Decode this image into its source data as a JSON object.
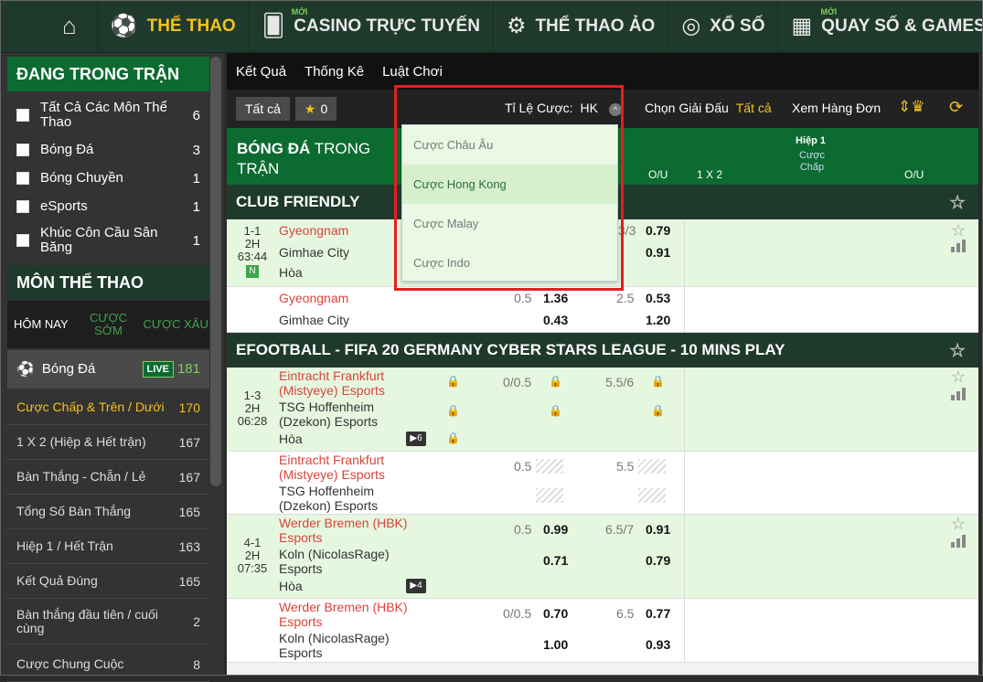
{
  "nav": {
    "home": "home-icon",
    "items": [
      {
        "label": "THỂ THAO",
        "active": true,
        "icon": "soccer-ball-icon"
      },
      {
        "label": "CASINO TRỰC TUYẾN",
        "badge": "MỚI",
        "icon": "cards-icon"
      },
      {
        "label": "THỂ THAO ẢO",
        "icon": "virtual-sports-icon"
      },
      {
        "label": "XỔ SỐ",
        "icon": "lottery-icon"
      },
      {
        "label": "QUAY SỐ & GAMES",
        "badge": "MỚI",
        "icon": "slot-machine-icon"
      }
    ]
  },
  "sidebar": {
    "live_title": "ĐANG TRONG TRẬN",
    "live_items": [
      {
        "label": "Tất Cả Các Môn Thể Thao",
        "count": "6"
      },
      {
        "label": "Bóng Đá",
        "count": "3"
      },
      {
        "label": "Bóng Chuyền",
        "count": "1"
      },
      {
        "label": "eSports",
        "count": "1"
      },
      {
        "label": "Khúc Côn Cầu Sân Băng",
        "count": "1"
      }
    ],
    "sports_title": "MÔN THỂ THAO",
    "tabs": [
      "HÔM NAY",
      "CƯỢC SỚM",
      "CƯỢC XÂU"
    ],
    "sport": {
      "label": "Bóng Đá",
      "live": "LIVE",
      "count": "181"
    },
    "menu": [
      {
        "label": "Cược Chấp & Trên / Dưới",
        "count": "170",
        "active": true
      },
      {
        "label": "1 X 2 (Hiệp & Hết trận)",
        "count": "167"
      },
      {
        "label": "Bàn Thắng - Chẵn / Lẻ",
        "count": "167"
      },
      {
        "label": "Tổng Số Bàn Thắng",
        "count": "165"
      },
      {
        "label": "Hiệp 1 / Hết Trận",
        "count": "163"
      },
      {
        "label": "Kết Quả Đúng",
        "count": "165"
      },
      {
        "label": "Bàn thắng đầu tiên / cuối cùng",
        "count": "2"
      },
      {
        "label": "Cược Chung Cuộc",
        "count": "8"
      }
    ]
  },
  "subtabs": [
    "Kết Quả",
    "Thống Kê",
    "Luật Chơi"
  ],
  "toolbar": {
    "all": "Tất cả",
    "fav_count": "0",
    "odds_label": "Tỉ Lệ Cược:",
    "odds_value": "HK",
    "league_label": "Chọn Giải Đấu",
    "league_value": "Tất cả",
    "single_view": "Xem Hàng Đơn"
  },
  "dropdown": {
    "options": [
      "Cược Châu Âu",
      "Cược Hong Kong",
      "Cược Malay",
      "Cược Indo"
    ],
    "selected": 1
  },
  "header": {
    "title_a": "BÓNG ĐÁ",
    "title_b": "TRONG",
    "title_c": "TRẬN",
    "col_ou": "O/U",
    "col_1x2": "1 X 2",
    "half": "Hiệp 1",
    "col_handicap": "Cược Chấp",
    "col_ou2": "O/U"
  },
  "leagues": [
    {
      "name": "CLUB FRIENDLY"
    },
    {
      "name": "EFOOTBALL - FIFA 20 GERMANY CYBER STARS LEAGUE - 10 MINS PLAY"
    }
  ],
  "m1": {
    "score": "1-1",
    "half": "2H",
    "time": "63:44",
    "n": "N",
    "home": "Gyeongnam",
    "away": "Gimhae City",
    "draw": "Hòa",
    "ou_line": "3/3",
    "ou_over": "0.79",
    "ou_under": "0.91"
  },
  "m1b": {
    "home": "Gyeongnam",
    "away": "Gimhae City",
    "hdp": "0.5",
    "hdp_home": "1.36",
    "hdp_away": "0.43",
    "ou_line": "2.5",
    "ou_over": "0.53",
    "ou_under": "1.20"
  },
  "m2": {
    "score": "1-3",
    "half": "2H",
    "time": "06:28",
    "home": "Eintracht Frankfurt (Mistyeye) Esports",
    "away": "TSG Hoffenheim (Dzekon) Esports",
    "draw": "Hòa",
    "hdp": "0/0.5",
    "ou_line": "5.5/6",
    "badge": "6"
  },
  "m2b": {
    "home": "Eintracht Frankfurt (Mistyeye) Esports",
    "away": "TSG Hoffenheim (Dzekon) Esports",
    "hdp": "0.5",
    "ou_line": "5.5"
  },
  "m3": {
    "score": "4-1",
    "half": "2H",
    "time": "07:35",
    "home": "Werder Bremen (HBK) Esports",
    "away": "Koln (NicolasRage) Esports",
    "draw": "Hòa",
    "hdp": "0.5",
    "hdp_home": "0.99",
    "hdp_away": "0.71",
    "ou_line": "6.5/7",
    "ou_over": "0.91",
    "ou_under": "0.79",
    "badge": "4"
  },
  "m3b": {
    "home": "Werder Bremen (HBK) Esports",
    "away": "Koln (NicolasRage) Esports",
    "hdp": "0/0.5",
    "hdp_home": "0.70",
    "hdp_away": "1.00",
    "ou_line": "6.5",
    "ou_over": "0.77",
    "ou_under": "0.93"
  }
}
